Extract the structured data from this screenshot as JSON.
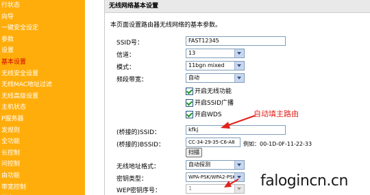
{
  "sidebar": {
    "items": [
      {
        "label": "行状态",
        "active": false
      },
      {
        "label": "向导",
        "active": false
      },
      {
        "label": "一键安全设定",
        "active": false
      },
      {
        "label": "参数",
        "active": false
      },
      {
        "label": "设置",
        "active": false
      },
      {
        "label": "基本设置",
        "active": true
      },
      {
        "label": "无线安全设置",
        "active": false
      },
      {
        "label": "无线MAC地址过滤",
        "active": false
      },
      {
        "label": "无线高级设置",
        "active": false
      },
      {
        "label": "主机状态",
        "active": false
      },
      {
        "label": "P服务器",
        "active": false
      },
      {
        "label": "发规则",
        "active": false
      },
      {
        "label": "全功能",
        "active": false
      },
      {
        "label": "长控制",
        "active": false
      },
      {
        "label": "问控制",
        "active": false
      },
      {
        "label": "由功能",
        "active": false
      },
      {
        "label": "带宽控制",
        "active": false
      },
      {
        "label": "绑定",
        "active": false
      }
    ]
  },
  "panel": {
    "title": "无线网络基本设置",
    "description": "本页面设置路由器无线网络的基本参数。"
  },
  "form": {
    "ssid_label": "SSID号：",
    "ssid_value": "FAST12345",
    "channel_label": "信道：",
    "channel_value": "13",
    "mode_label": "模式：",
    "mode_value": "11bgn mixed",
    "bandwidth_label": "频段带宽：",
    "bandwidth_value": "自动",
    "enable_wireless_label": "开启无线功能",
    "enable_ssid_broadcast_label": "开启SSID广播",
    "enable_wds_label": "开启WDS",
    "bridged_ssid_label": "(桥接的)SSID：",
    "bridged_ssid_value": "kfkj",
    "bridged_bssid_label": "(桥接的)BSSID：",
    "bridged_bssid_value": "CC-34-29-35-C6-A8",
    "bssid_example": "例如：00-1D-0F-11-22-33",
    "scan_label": "扫描",
    "addr_format_label": "无线地址格式：",
    "addr_format_value": "自动探测",
    "key_type_label": "密钥类型：",
    "key_type_value": "WPA-PSK/WPA2-PSK",
    "wep_index_label": "WEP密钥序号：",
    "wep_index_value": "1"
  },
  "annotation": {
    "text": "自动填主路由",
    "color": "#e2231a"
  },
  "watermark": "falogincn.cn",
  "colors": {
    "sidebar_bg": "#ffad0a",
    "sidebar_active": "#d20000",
    "title_bar_bg": "#e9e9e9",
    "checkmark": "#1a9a1a"
  }
}
